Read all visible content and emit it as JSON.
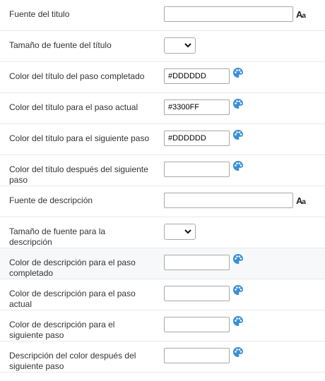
{
  "rows": [
    {
      "label": "Fuente del titulo",
      "type": "font",
      "value": "",
      "icon": "font-icon"
    },
    {
      "label": "Tamaño de fuente del título",
      "type": "select",
      "value": ""
    },
    {
      "label": "Color del título del paso completado",
      "type": "color",
      "value": "#DDDDDD",
      "icon": "palette-icon"
    },
    {
      "label": "Color del título para el paso actual",
      "type": "color",
      "value": "#3300FF",
      "icon": "palette-icon"
    },
    {
      "label": "Color del título para el siguiente paso",
      "type": "color",
      "value": "#DDDDDD",
      "icon": "palette-icon"
    },
    {
      "label": "Color del título después del siguiente paso",
      "type": "color",
      "value": "",
      "icon": "palette-icon"
    },
    {
      "label": "Fuente de descripción",
      "type": "font",
      "value": "",
      "icon": "font-icon"
    },
    {
      "label": "Tamaño de fuente para la descripción",
      "type": "select",
      "value": ""
    },
    {
      "label": "Color de descripción para el paso completado",
      "type": "color",
      "value": "",
      "icon": "palette-icon"
    },
    {
      "label": "Color de descripción para el paso actual",
      "type": "color",
      "value": "",
      "icon": "palette-icon"
    },
    {
      "label": "Color de descripción para el siguiente paso",
      "type": "color",
      "value": "",
      "icon": "palette-icon"
    },
    {
      "label": "Descripción del color después del siguiente paso",
      "type": "color",
      "value": "",
      "icon": "palette-icon"
    }
  ],
  "font_icon_text": {
    "big": "A",
    "small": "a"
  },
  "colors": {
    "palette": "#3a8fd6",
    "row_highlight": "#f7f8fa",
    "border": "#e9e9e9"
  }
}
